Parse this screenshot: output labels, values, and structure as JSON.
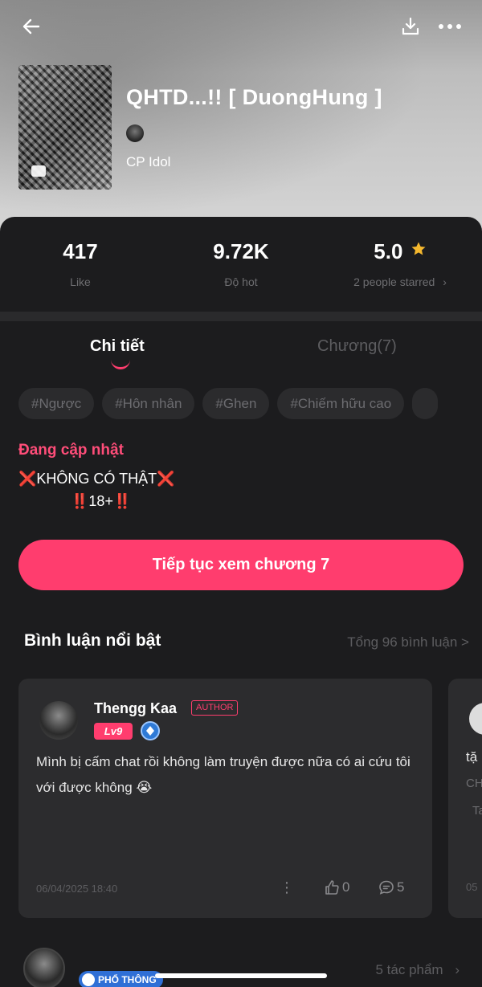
{
  "header": {
    "back_icon": "arrow-left-icon",
    "download_icon": "download-icon",
    "more_icon": "more-horizontal-icon",
    "title": "QHTD...!! [ DuongHung ]",
    "author": "CP Idol"
  },
  "stats": {
    "likes_value": "417",
    "likes_label": "Like",
    "hot_value": "9.72K",
    "hot_label": "Độ hot",
    "rating_value": "5.0",
    "rating_label": "2 people starred",
    "star_color": "#f5b82e"
  },
  "tabs": {
    "details": "Chi tiết",
    "chapters": "Chương(7)"
  },
  "tags": [
    "#Ngược",
    "#Hôn nhân",
    "#Ghen",
    "#Chiếm hữu cao"
  ],
  "description": {
    "status": "Đang cập nhật",
    "line1_text": "KHÔNG CÓ THẬT",
    "line2_text": "18+"
  },
  "cta": {
    "label": "Tiếp tục xem chương 7"
  },
  "comments": {
    "title": "Bình luận nổi bật",
    "total": "Tổng 96 bình luận >",
    "featured": {
      "name": "Thengg Kaa",
      "role_badge": "AUTHOR",
      "level": "Lv9",
      "text": "Mình bị cấm chat rồi không làm truyện được nữa có ai cứu tôi với được không 😭",
      "time": "06/04/2025 18:40",
      "likes": "0",
      "replies": "5"
    },
    "peek": {
      "line1": "tặ",
      "line2": "CH",
      "line3": "Ta",
      "time": "05"
    }
  },
  "author_footer": {
    "badge": "PHỔ THÔNG",
    "works": "5 tác phẩm"
  },
  "colors": {
    "accent": "#ff3d6e",
    "background": "#1c1c1e",
    "card": "#2c2c2e"
  }
}
